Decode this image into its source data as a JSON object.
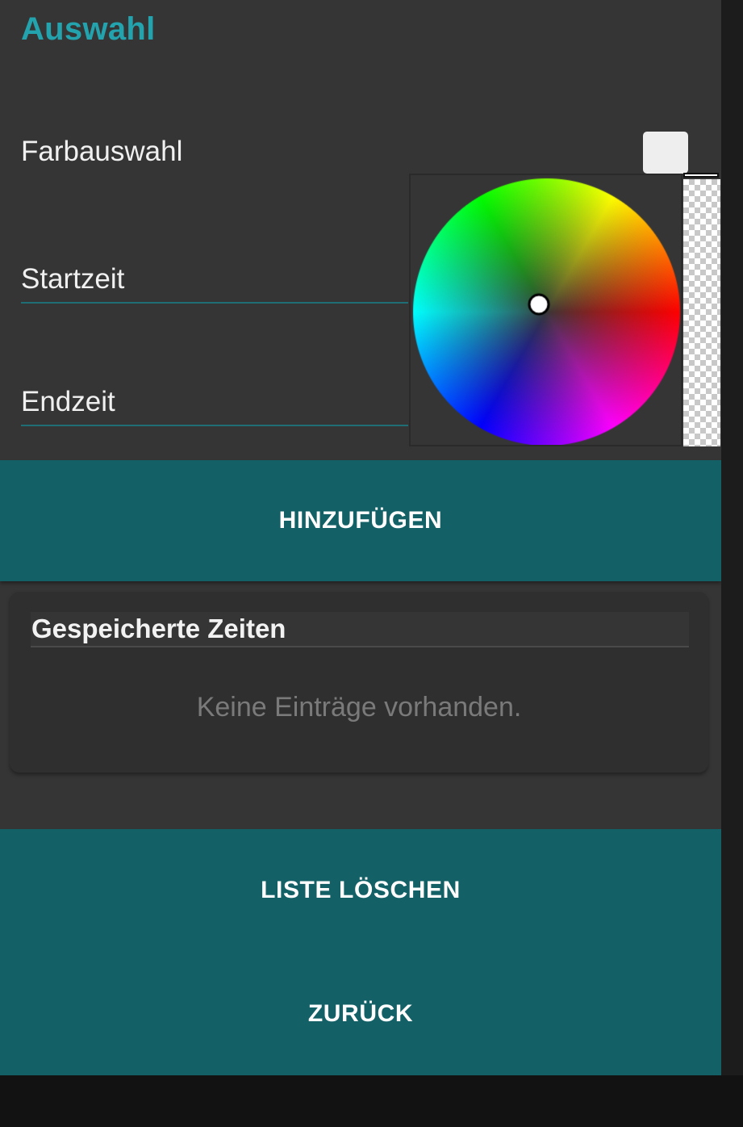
{
  "header": {
    "title": "Auswahl"
  },
  "form": {
    "color_label": "Farbauswahl",
    "start_label": "Startzeit",
    "end_label": "Endzeit",
    "selected_color": "#eeeeee"
  },
  "color_picker": {
    "icon": "color-wheel-icon",
    "alpha_bar_icon": "checkerboard-alpha-icon"
  },
  "buttons": {
    "add": "HINZUFÜGEN",
    "clear_list": "LISTE LÖSCHEN",
    "back": "ZURÜCK"
  },
  "saved_times": {
    "title": "Gespeicherte Zeiten",
    "empty_message": "Keine Einträge vorhanden."
  },
  "colors": {
    "accent": "#23a3ad",
    "button": "#136167",
    "background": "#353535"
  }
}
